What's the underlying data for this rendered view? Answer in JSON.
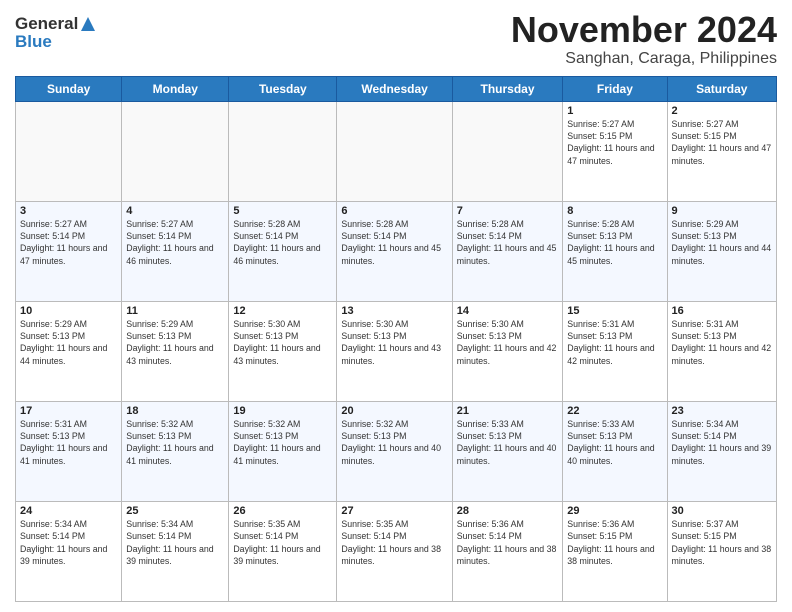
{
  "logo": {
    "general": "General",
    "blue": "Blue"
  },
  "title": {
    "month": "November 2024",
    "location": "Sanghan, Caraga, Philippines"
  },
  "days_of_week": [
    "Sunday",
    "Monday",
    "Tuesday",
    "Wednesday",
    "Thursday",
    "Friday",
    "Saturday"
  ],
  "weeks": [
    [
      {
        "day": "",
        "info": ""
      },
      {
        "day": "",
        "info": ""
      },
      {
        "day": "",
        "info": ""
      },
      {
        "day": "",
        "info": ""
      },
      {
        "day": "",
        "info": ""
      },
      {
        "day": "1",
        "info": "Sunrise: 5:27 AM\nSunset: 5:15 PM\nDaylight: 11 hours and 47 minutes."
      },
      {
        "day": "2",
        "info": "Sunrise: 5:27 AM\nSunset: 5:15 PM\nDaylight: 11 hours and 47 minutes."
      }
    ],
    [
      {
        "day": "3",
        "info": "Sunrise: 5:27 AM\nSunset: 5:14 PM\nDaylight: 11 hours and 47 minutes."
      },
      {
        "day": "4",
        "info": "Sunrise: 5:27 AM\nSunset: 5:14 PM\nDaylight: 11 hours and 46 minutes."
      },
      {
        "day": "5",
        "info": "Sunrise: 5:28 AM\nSunset: 5:14 PM\nDaylight: 11 hours and 46 minutes."
      },
      {
        "day": "6",
        "info": "Sunrise: 5:28 AM\nSunset: 5:14 PM\nDaylight: 11 hours and 45 minutes."
      },
      {
        "day": "7",
        "info": "Sunrise: 5:28 AM\nSunset: 5:14 PM\nDaylight: 11 hours and 45 minutes."
      },
      {
        "day": "8",
        "info": "Sunrise: 5:28 AM\nSunset: 5:13 PM\nDaylight: 11 hours and 45 minutes."
      },
      {
        "day": "9",
        "info": "Sunrise: 5:29 AM\nSunset: 5:13 PM\nDaylight: 11 hours and 44 minutes."
      }
    ],
    [
      {
        "day": "10",
        "info": "Sunrise: 5:29 AM\nSunset: 5:13 PM\nDaylight: 11 hours and 44 minutes."
      },
      {
        "day": "11",
        "info": "Sunrise: 5:29 AM\nSunset: 5:13 PM\nDaylight: 11 hours and 43 minutes."
      },
      {
        "day": "12",
        "info": "Sunrise: 5:30 AM\nSunset: 5:13 PM\nDaylight: 11 hours and 43 minutes."
      },
      {
        "day": "13",
        "info": "Sunrise: 5:30 AM\nSunset: 5:13 PM\nDaylight: 11 hours and 43 minutes."
      },
      {
        "day": "14",
        "info": "Sunrise: 5:30 AM\nSunset: 5:13 PM\nDaylight: 11 hours and 42 minutes."
      },
      {
        "day": "15",
        "info": "Sunrise: 5:31 AM\nSunset: 5:13 PM\nDaylight: 11 hours and 42 minutes."
      },
      {
        "day": "16",
        "info": "Sunrise: 5:31 AM\nSunset: 5:13 PM\nDaylight: 11 hours and 42 minutes."
      }
    ],
    [
      {
        "day": "17",
        "info": "Sunrise: 5:31 AM\nSunset: 5:13 PM\nDaylight: 11 hours and 41 minutes."
      },
      {
        "day": "18",
        "info": "Sunrise: 5:32 AM\nSunset: 5:13 PM\nDaylight: 11 hours and 41 minutes."
      },
      {
        "day": "19",
        "info": "Sunrise: 5:32 AM\nSunset: 5:13 PM\nDaylight: 11 hours and 41 minutes."
      },
      {
        "day": "20",
        "info": "Sunrise: 5:32 AM\nSunset: 5:13 PM\nDaylight: 11 hours and 40 minutes."
      },
      {
        "day": "21",
        "info": "Sunrise: 5:33 AM\nSunset: 5:13 PM\nDaylight: 11 hours and 40 minutes."
      },
      {
        "day": "22",
        "info": "Sunrise: 5:33 AM\nSunset: 5:13 PM\nDaylight: 11 hours and 40 minutes."
      },
      {
        "day": "23",
        "info": "Sunrise: 5:34 AM\nSunset: 5:14 PM\nDaylight: 11 hours and 39 minutes."
      }
    ],
    [
      {
        "day": "24",
        "info": "Sunrise: 5:34 AM\nSunset: 5:14 PM\nDaylight: 11 hours and 39 minutes."
      },
      {
        "day": "25",
        "info": "Sunrise: 5:34 AM\nSunset: 5:14 PM\nDaylight: 11 hours and 39 minutes."
      },
      {
        "day": "26",
        "info": "Sunrise: 5:35 AM\nSunset: 5:14 PM\nDaylight: 11 hours and 39 minutes."
      },
      {
        "day": "27",
        "info": "Sunrise: 5:35 AM\nSunset: 5:14 PM\nDaylight: 11 hours and 38 minutes."
      },
      {
        "day": "28",
        "info": "Sunrise: 5:36 AM\nSunset: 5:14 PM\nDaylight: 11 hours and 38 minutes."
      },
      {
        "day": "29",
        "info": "Sunrise: 5:36 AM\nSunset: 5:15 PM\nDaylight: 11 hours and 38 minutes."
      },
      {
        "day": "30",
        "info": "Sunrise: 5:37 AM\nSunset: 5:15 PM\nDaylight: 11 hours and 38 minutes."
      }
    ]
  ]
}
